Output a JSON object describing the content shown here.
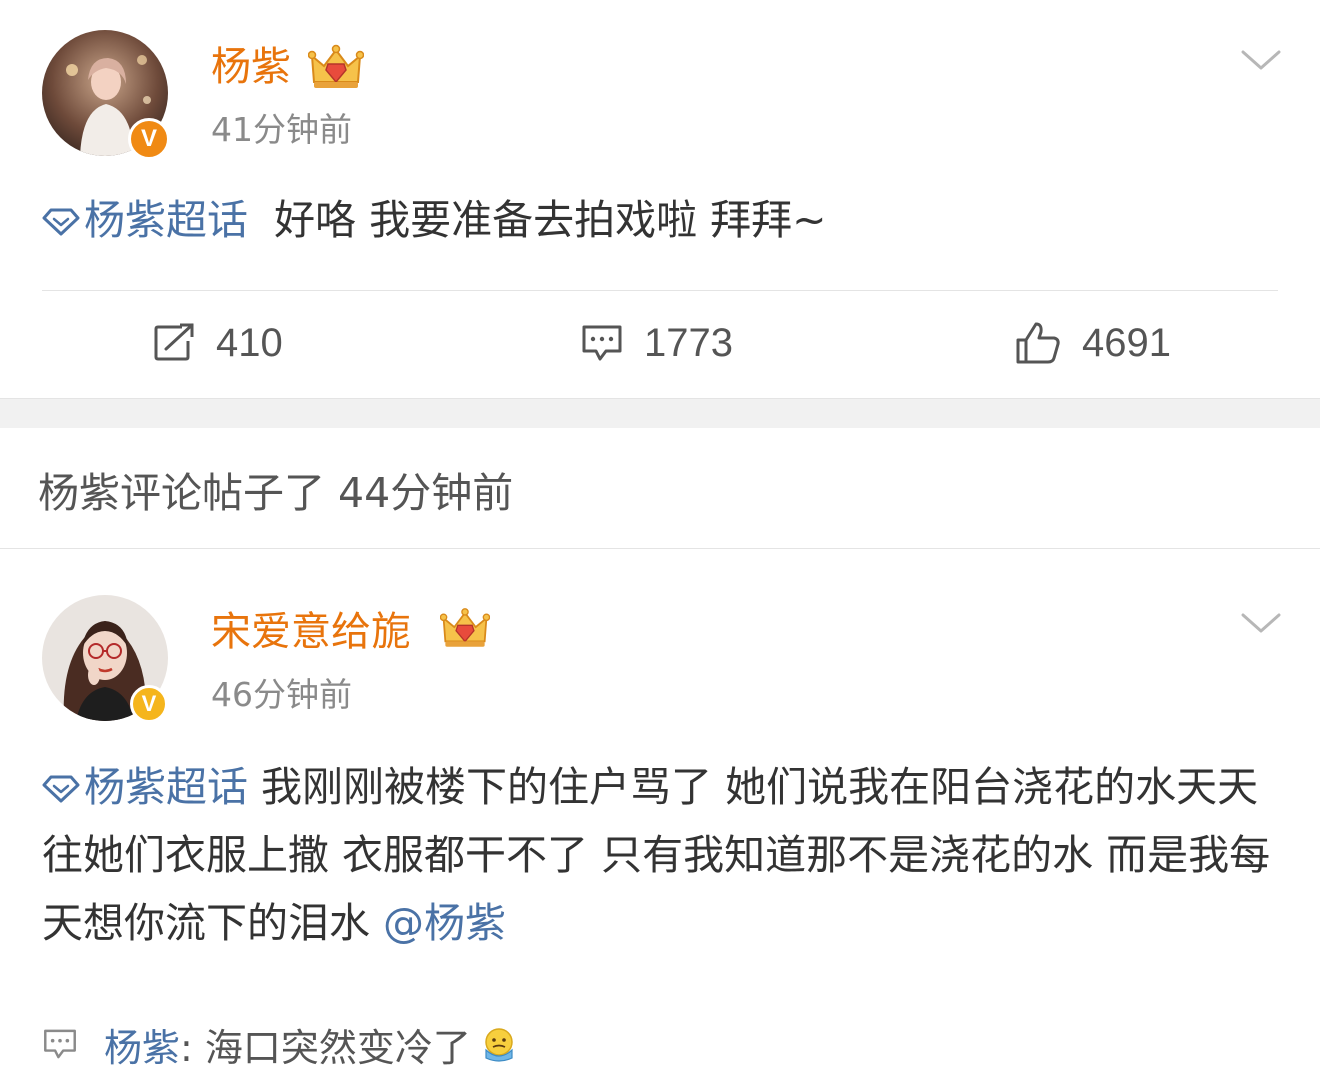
{
  "posts": [
    {
      "username": "杨紫",
      "time": "41分钟前",
      "topic": "杨紫超话",
      "text": "好咯 我要准备去拍戏啦 拜拜~",
      "actions": {
        "repost_count": "410",
        "comment_count": "1773",
        "like_count": "4691"
      }
    },
    {
      "username": "宋爱意给旎",
      "time": "46分钟前",
      "topic": "杨紫超话",
      "text": "我刚刚被楼下的住户骂了 她们说我在阳台浇花的水天天往她们衣服上撒 衣服都干不了 只有我知道那不是浇花的水 而是我每天想你流下的泪水 ",
      "mention": "@杨紫",
      "reply": {
        "user": "杨紫",
        "text": ": 海口突然变冷了"
      }
    }
  ],
  "notice": {
    "text": "杨紫评论帖子了 44分钟前"
  },
  "colors": {
    "username": "#e8740c",
    "link": "#4a72a6",
    "badge_orange": "#f08a14",
    "badge_gold": "#f5b51c",
    "time": "#8a8a8a",
    "separator": "#f1f1f1"
  },
  "icons": {
    "badge_glyph": "V",
    "repost": "repost-icon",
    "comment": "comment-icon",
    "like": "like-icon",
    "crown": "crown-icon",
    "chevron": "chevron-down-icon",
    "topic": "diamond-icon",
    "emoji": "cold-emoji-icon"
  }
}
